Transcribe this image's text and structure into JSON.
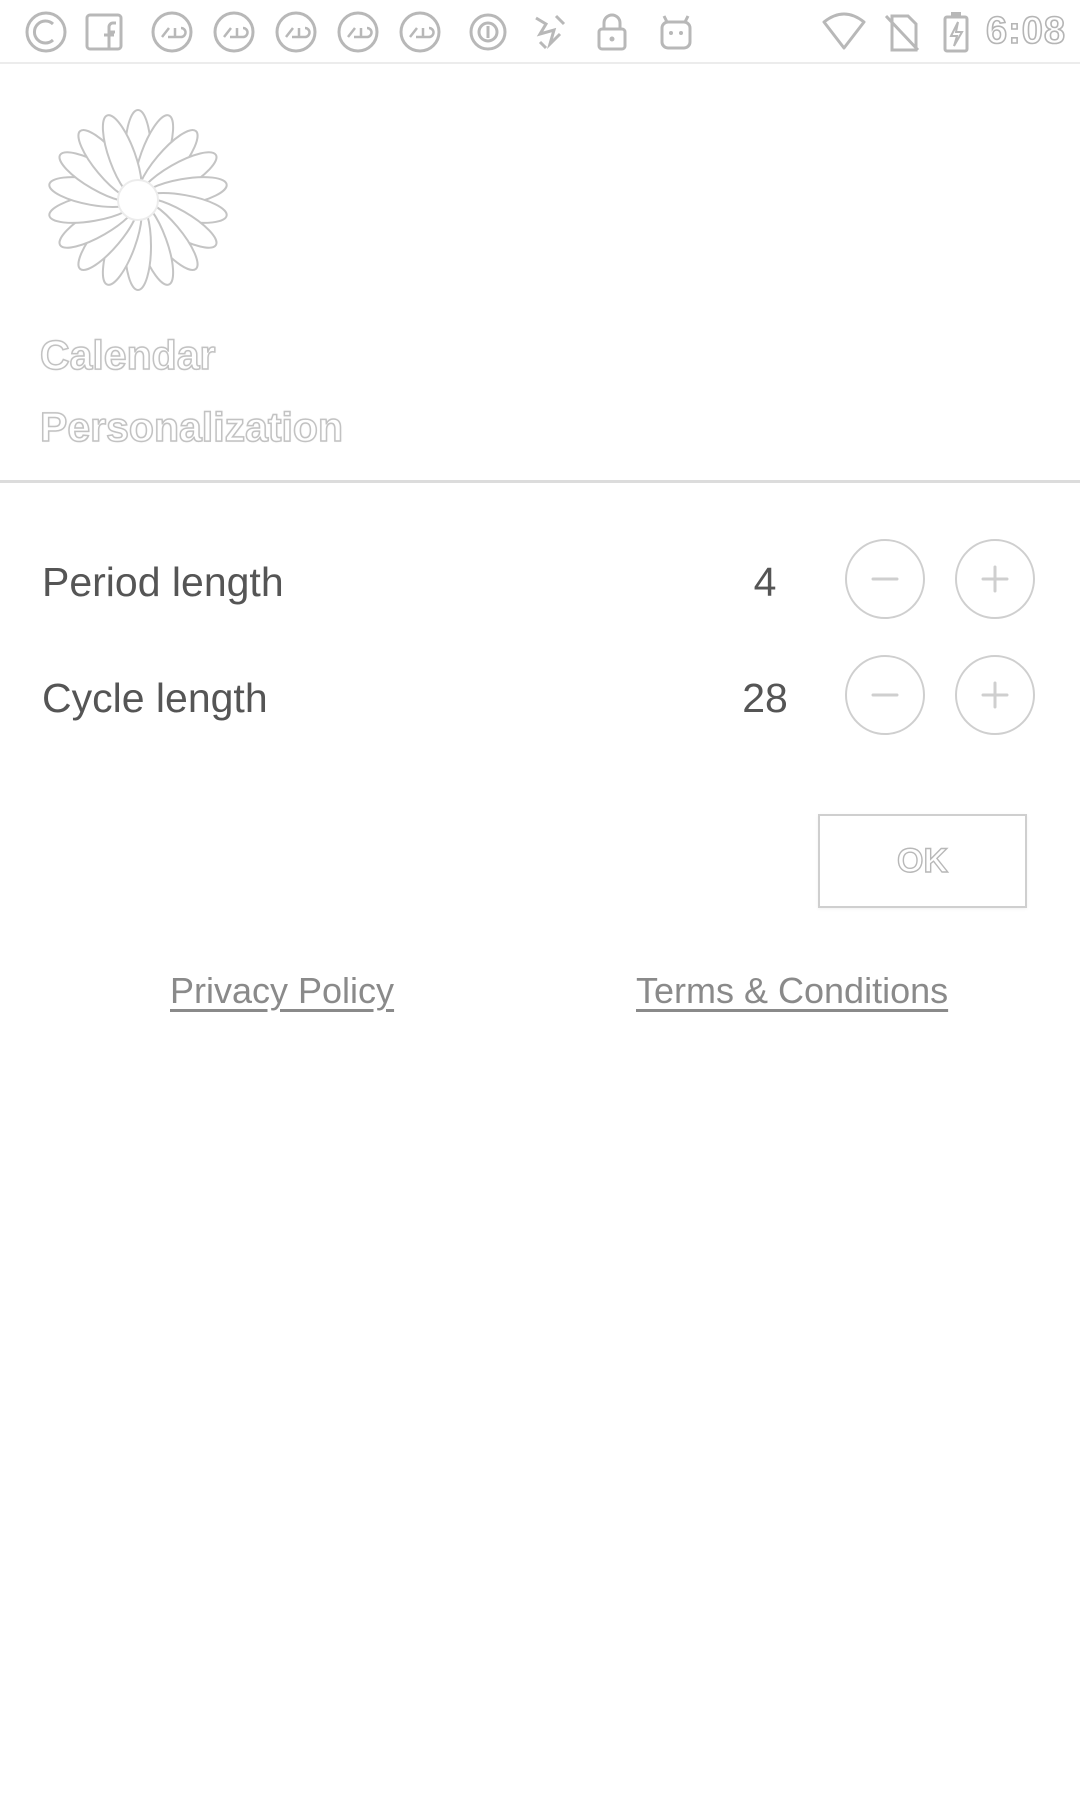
{
  "status_bar": {
    "time": "6:08",
    "notification_icons": [
      "c-app-icon",
      "facebook-icon",
      "rto-icon",
      "rto-icon",
      "rto-icon",
      "rto-icon",
      "rto-icon",
      "circle-app-icon",
      "signal-app-icon",
      "lock-icon",
      "android-icon"
    ],
    "system_icons": [
      "wifi-icon",
      "no-sim-icon",
      "battery-charging-icon"
    ]
  },
  "header": {
    "logo_icon": "daisy-flower-icon",
    "title_line1": "Calendar",
    "title_line2": "Personalization"
  },
  "settings": {
    "period": {
      "label": "Period length",
      "value": "4"
    },
    "cycle": {
      "label": "Cycle length",
      "value": "28"
    }
  },
  "actions": {
    "ok_label": "OK"
  },
  "links": {
    "privacy": "Privacy Policy",
    "terms": "Terms & Conditions"
  },
  "colors": {
    "background": "#ffffff",
    "outline": "#c8c8c8",
    "text": "#555555"
  }
}
